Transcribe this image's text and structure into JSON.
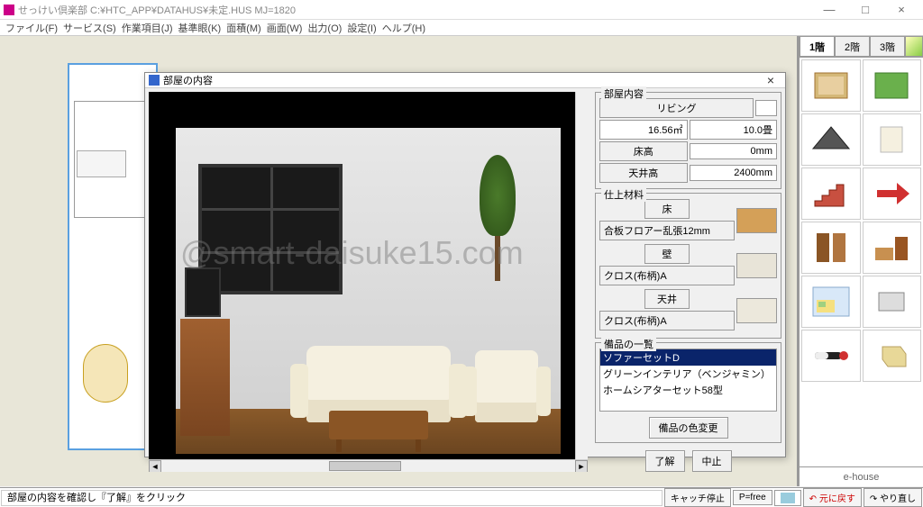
{
  "window": {
    "title": "せっけい倶楽部 C:¥HTC_APP¥DATAHUS¥未定.HUS  MJ=1820",
    "minimize": "—",
    "maximize": "□",
    "close": "×"
  },
  "menu": {
    "file": "ファイル(F)",
    "service": "サービス(S)",
    "work": "作業項目(J)",
    "grid": "基準眼(K)",
    "area": "面積(M)",
    "screen": "画面(W)",
    "output": "出力(O)",
    "settings": "設定(I)",
    "help": "ヘルプ(H)"
  },
  "floortabs": {
    "f1": "1階",
    "f2": "2階",
    "f3": "3階"
  },
  "ehouse": "e-house",
  "dialog": {
    "title": "部屋の内容",
    "close": "×",
    "sec_room": "部屋内容",
    "room_name": "リビング",
    "area_m2": "16.56㎡",
    "area_tatami": "10.0畳",
    "floor_h_lbl": "床高",
    "floor_h_val": "0mm",
    "ceil_h_lbl": "天井高",
    "ceil_h_val": "2400mm",
    "sec_material": "仕上材料",
    "floor_lbl": "床",
    "floor_mat": "合板フロアー乱張12mm",
    "wall_lbl": "壁",
    "wall_mat": "クロス(布柄)A",
    "ceil_lbl": "天井",
    "ceil_mat": "クロス(布柄)A",
    "sec_items": "備品の一覧",
    "items": [
      "ソファーセットD",
      "グリーンインテリア（ベンジャミン）",
      "ホームシアターセット58型"
    ],
    "btn_color": "備品の色変更",
    "btn_ok": "了解",
    "btn_cancel": "中止"
  },
  "status": {
    "msg": "部屋の内容を確認し『了解』をクリック",
    "catch": "キャッチ停止",
    "pfree": "P=free",
    "undo": "元に戻す",
    "redo": "やり直し"
  },
  "watermark": "@smart-daisuke15.com"
}
